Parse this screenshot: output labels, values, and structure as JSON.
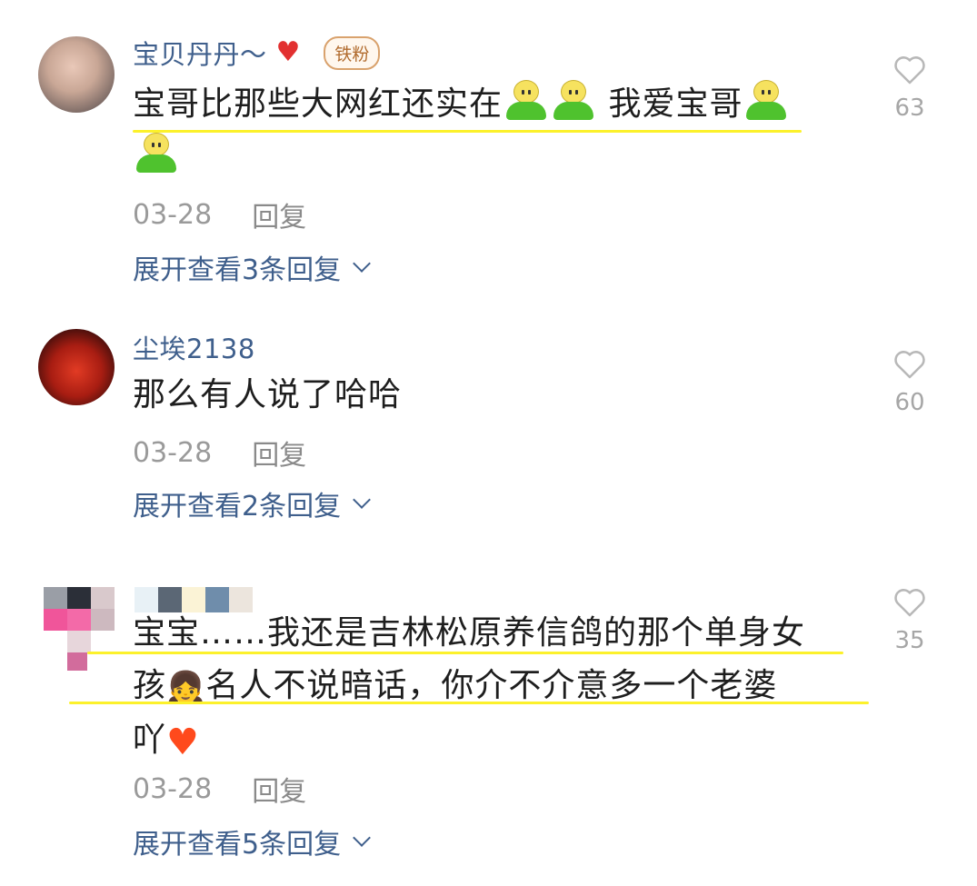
{
  "comments": [
    {
      "username": "宝贝丹丹～",
      "badge": "铁粉",
      "text_part1": "宝哥比那些大网红还实在",
      "text_part2": "我爱宝哥",
      "date": "03-28",
      "reply_label": "回复",
      "expand_label": "展开查看3条回复",
      "likes": "63"
    },
    {
      "username": "尘埃2138",
      "text": "那么有人说了哈哈",
      "date": "03-28",
      "reply_label": "回复",
      "expand_label": "展开查看2条回复",
      "likes": "60"
    },
    {
      "text_line1": "宝宝……我还是吉林松原养信鸽的那个单身女",
      "text_line2a": "孩",
      "text_line2b": "名人不说暗话，你介不介意多一个老婆",
      "text_line3": "吖",
      "date": "03-28",
      "reply_label": "回复",
      "expand_label": "展开查看5条回复",
      "likes": "35"
    }
  ],
  "colors": {
    "username": "#3f5f8c",
    "highlight": "#fcf12b",
    "meta": "#9a9a9a",
    "like_count": "#a6a6a6"
  },
  "icons": {
    "like": "heart-outline-icon",
    "expand": "chevron-down-icon",
    "emoji_person": "person-emoji",
    "emoji_girl": "girl-emoji",
    "emoji_heart": "red-heart-emoji"
  }
}
